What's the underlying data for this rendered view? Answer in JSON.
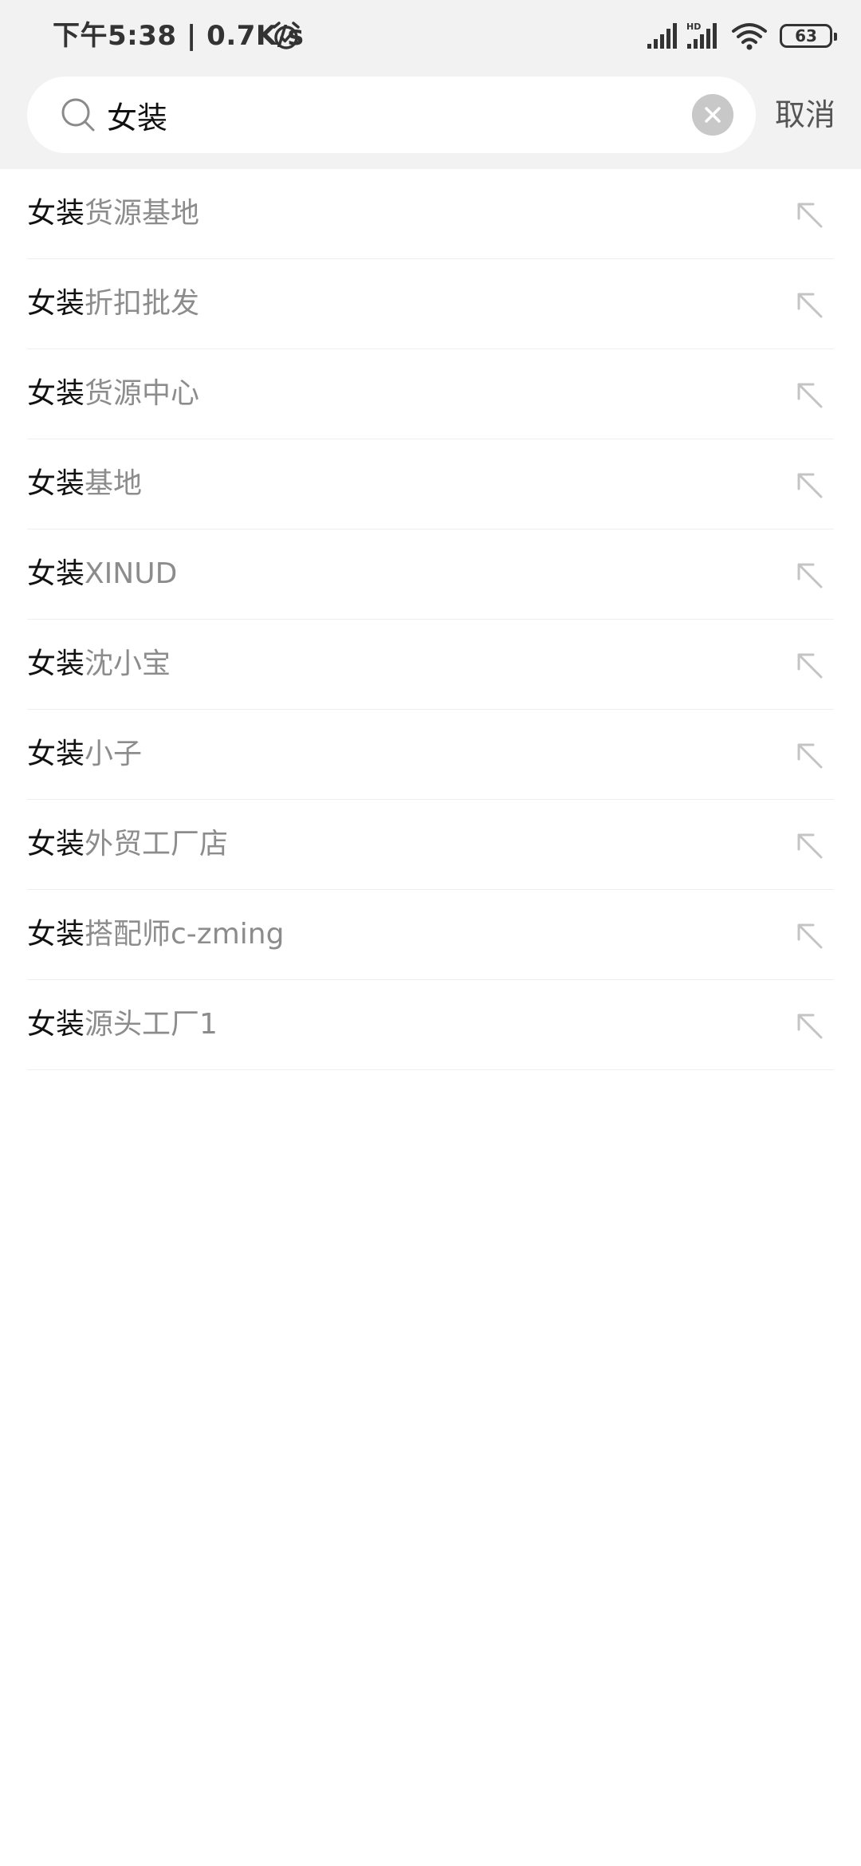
{
  "status_bar": {
    "time": "下午5:38 | 0.7K/s",
    "battery": "63",
    "icons": [
      "alarm-icon",
      "signal-icon",
      "hd-signal-icon",
      "wifi-icon",
      "battery-icon"
    ]
  },
  "search": {
    "value": "女装",
    "placeholder": "",
    "cancel_label": "取消",
    "icons": [
      "search-icon",
      "clear-icon"
    ]
  },
  "suggestions": [
    {
      "keyword": "女装",
      "rest": "货源基地"
    },
    {
      "keyword": "女装",
      "rest": "折扣批发"
    },
    {
      "keyword": "女装",
      "rest": "货源中心"
    },
    {
      "keyword": "女装",
      "rest": "基地"
    },
    {
      "keyword": "女装",
      "rest": "XINUD"
    },
    {
      "keyword": "女装",
      "rest": "沈小宝"
    },
    {
      "keyword": "女装",
      "rest": "小子"
    },
    {
      "keyword": "女装",
      "rest": "外贸工厂店"
    },
    {
      "keyword": "女装",
      "rest": "搭配师c-zming"
    },
    {
      "keyword": "女装",
      "rest": "源头工厂1"
    }
  ],
  "colors": {
    "header_bg": "#f2f2f2",
    "keyword": "#111111",
    "suggestion_rest": "#8c8c8c",
    "divider": "#eeeeee",
    "clear_button": "#c8c8c8"
  }
}
